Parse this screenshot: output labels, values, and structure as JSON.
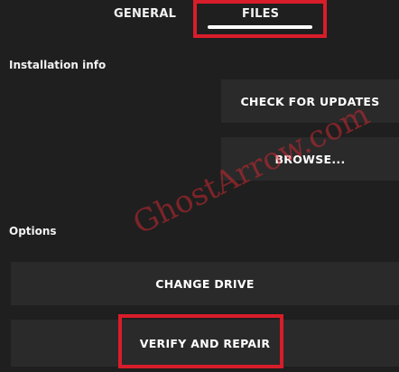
{
  "tabs": {
    "general_label": "GENERAL",
    "files_label": "FILES",
    "active_tab": "FILES"
  },
  "installation": {
    "section_label": "Installation info",
    "check_updates_label": "CHECK FOR UPDATES",
    "browse_label": "BROWSE..."
  },
  "options": {
    "section_label": "Options",
    "change_drive_label": "CHANGE DRIVE",
    "verify_repair_label": "VERIFY AND REPAIR"
  },
  "watermark": {
    "text": "GhostArrow.com"
  },
  "colors": {
    "background": "#1f1f1f",
    "button_background": "#2a2a2a",
    "highlight": "#d81d2a",
    "text": "#ffffff"
  }
}
